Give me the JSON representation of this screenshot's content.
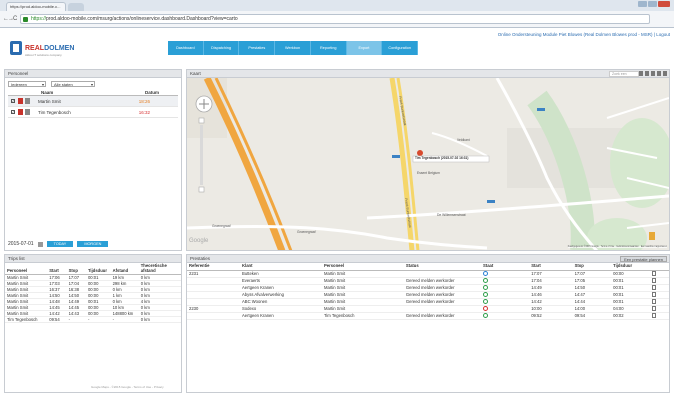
{
  "browser": {
    "tab_title": "https://prod.aldoo-mobile.c...",
    "url_secure": "https://",
    "url_rest": "prod.aldoo-mobile.com/msurg/actions/onlineservice.dashboard.Dashboard?view=carto"
  },
  "brand": {
    "name_main": "REAL",
    "name_accent": "DOLMEN",
    "tagline": "Aldoo.IT solutions company"
  },
  "top_links": "Online Ondersteuning   Module   Piet Blowes (Real Dolmen Blowes prod - MSR)  |  Logout",
  "nav": [
    "Dashboard",
    "Dispatching",
    "Prestaties",
    "Werkbon",
    "Reporting",
    "Export",
    "Configuration"
  ],
  "nav_active": 5,
  "personeel": {
    "title": "Personeel",
    "filter1": "Iedereen",
    "filter2": "Alle staten",
    "col_name": "Naam",
    "col_date": "Datum",
    "rows": [
      {
        "check": "✓",
        "name": "Martin Smit",
        "date": "18:26",
        "red": false
      },
      {
        "check": "✓",
        "name": "Tim Tegenbosch",
        "date": "16:32",
        "red": true
      }
    ],
    "date": "2015-07-01",
    "btn_today": "TODAY",
    "btn_tomorrow": "MORGEN"
  },
  "kaart": {
    "title": "Kaart",
    "search_placeholder": "Zoek een voorwaarde",
    "popup": "Tim Tegenbosch (2015-07-02 16:31)",
    "labels": {
      "road1": "Frank Buntwetstraat",
      "road2": "Frank Buntwetstraat",
      "street1": "Veldkant",
      "street2": "De Willemsenstraat",
      "street3": "Essent Belgium",
      "street4": "Groenegraaf",
      "street5": "Groenegraaf",
      "google": "Google",
      "attrib": "Kaartgegevens ©2015 Google · Terms of Use · Gebruiksvoorwaarden · Een kaartfout rapporteren"
    }
  },
  "trips": {
    "title": "Trips list",
    "headers": [
      "Personeel",
      "Start",
      "Stop",
      "Tijdsduur",
      "Afstand",
      "Theoretische afstand"
    ],
    "rows": [
      [
        "Martin Smit",
        "17:06",
        "17:07",
        "00:01",
        "19 km",
        "0 km"
      ],
      [
        "Martin Smit",
        "17:03",
        "17:04",
        "00:00",
        "298 km",
        "0 km"
      ],
      [
        "Martin Smit",
        "16:37",
        "16:38",
        "00:00",
        "0 km",
        "0 km"
      ],
      [
        "Martin Smit",
        "14:50",
        "14:50",
        "00:00",
        "1 km",
        "0 km"
      ],
      [
        "Martin Smit",
        "14:48",
        "14:49",
        "00:01",
        "0 km",
        "4 km"
      ],
      [
        "Martin Smit",
        "14:45",
        "14:45",
        "00:00",
        "10 km",
        "0 km"
      ],
      [
        "Martin Smit",
        "14:42",
        "14:43",
        "00:00",
        "148800 km",
        "0 km"
      ],
      [
        "Tim Tegenbosch",
        "09:54",
        "-",
        "-",
        "-",
        "0 km"
      ]
    ],
    "copyright": "Google Maps - ©2015 Google - Terms of Use - Privacy"
  },
  "prestaties": {
    "title": "Prestaties",
    "plan_button": "Een prestatie plannen",
    "headers": [
      "Referentie",
      "Klant",
      "Personeel",
      "Status",
      "Staat",
      "Start",
      "Stop",
      "Tijdsduur"
    ],
    "rows": [
      {
        "ref": "2231",
        "klant": "Butteken",
        "pers": "Martin Smit",
        "status": "",
        "staat": "blue",
        "start": "17:07",
        "stop": "17:07",
        "duur": "00:00"
      },
      {
        "ref": "",
        "klant": "Everaerts",
        "pers": "Martin Smit",
        "status": "Gereed melden werkorder",
        "staat": "green",
        "start": "17:04",
        "stop": "17:05",
        "duur": "00:01"
      },
      {
        "ref": "",
        "klant": "Aertgeen Kranen",
        "pers": "Martin Smit",
        "status": "Gereed melden werkorder",
        "staat": "green",
        "start": "14:49",
        "stop": "14:50",
        "duur": "00:01"
      },
      {
        "ref": "",
        "klant": "Abyss Afvalverwerking",
        "pers": "Martin Smit",
        "status": "Gereed melden werkorder",
        "staat": "green",
        "start": "14:46",
        "stop": "14:47",
        "duur": "00:01"
      },
      {
        "ref": "",
        "klant": "ABC Woonen",
        "pers": "Martin Smit",
        "status": "Gereed melden werkorder",
        "staat": "green",
        "start": "14:42",
        "stop": "14:44",
        "duur": "00:01"
      },
      {
        "ref": "2230",
        "klant": "Sodexo",
        "pers": "Martin Smit",
        "status": "",
        "staat": "red",
        "start": "10:00",
        "stop": "14:00",
        "duur": "04:00"
      },
      {
        "ref": "",
        "klant": "Aertgeen Kranen",
        "pers": "Tim Tegenbosch",
        "status": "Gereed melden werkorder",
        "staat": "green",
        "start": "09:52",
        "stop": "09:54",
        "duur": "00:02"
      }
    ]
  },
  "colors": {
    "accent": "#2a9fd6",
    "brand": "#2b6cb0",
    "alert": "#d63031",
    "ok": "#2e9e4a"
  }
}
